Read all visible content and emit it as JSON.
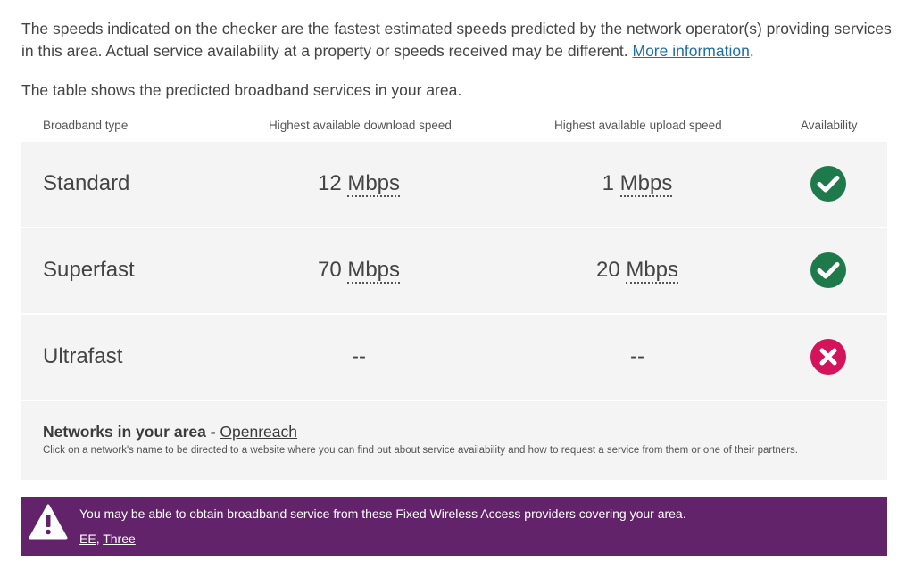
{
  "intro": {
    "text": "The speeds indicated on the checker are the fastest estimated speeds predicted by the network operator(s) providing services in this area. Actual service availability at a property or speeds received may be different.",
    "link": "More information",
    "end": "."
  },
  "table_intro": "The table shows the predicted broadband services in your area.",
  "table": {
    "headers": {
      "type": "Broadband type",
      "download": "Highest available download speed",
      "upload": "Highest available upload speed",
      "availability": "Availability"
    },
    "rows": [
      {
        "type": "Standard",
        "download_value": "12",
        "download_unit": "Mbps",
        "upload_value": "1",
        "upload_unit": "Mbps",
        "available": true
      },
      {
        "type": "Superfast",
        "download_value": "70",
        "download_unit": "Mbps",
        "upload_value": "20",
        "upload_unit": "Mbps",
        "available": true
      },
      {
        "type": "Ultrafast",
        "download": "--",
        "upload": "--",
        "available": false
      }
    ]
  },
  "networks": {
    "title": "Networks in your area - ",
    "link": "Openreach",
    "note": "Click on a network's name to be directed to a website where you can find out about service availability and how to request a service from them or one of their partners."
  },
  "fwa": {
    "message": "You may be able to obtain broadband service from these Fixed Wireless Access providers covering your area.",
    "providers": [
      "EE",
      "Three"
    ],
    "separator": ", "
  },
  "colors": {
    "available": "#1e7a4a",
    "unavailable": "#d4145a",
    "banner": "#63236a",
    "link": "#1d6fa5"
  },
  "icons": {
    "available": "check-circle-icon",
    "unavailable": "cross-circle-icon",
    "warning": "warning-triangle-icon"
  }
}
